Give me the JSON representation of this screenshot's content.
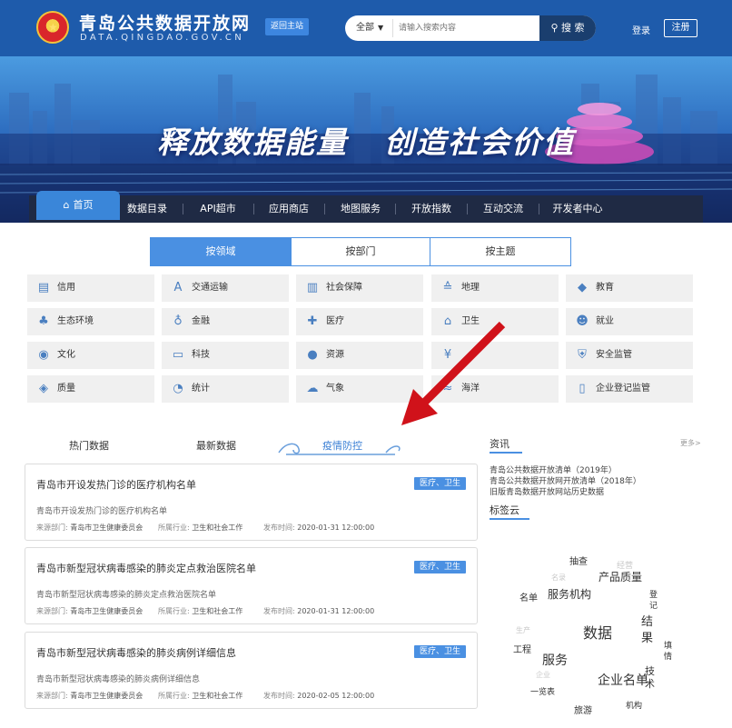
{
  "header": {
    "site_title": "青岛公共数据开放网",
    "site_subtitle": "DATA.QINGDAO.GOV.CN",
    "back_label": "返回主站",
    "search_scope": "全部",
    "search_placeholder": "请输入搜索内容",
    "search_button": "搜 索",
    "login": "登录",
    "register": "注册"
  },
  "banner": {
    "slogan_left": "释放数据能量",
    "slogan_right": "创造社会价值"
  },
  "nav": {
    "home": "首页",
    "items": [
      "数据目录",
      "API超市",
      "应用商店",
      "地图服务",
      "开放指数",
      "互动交流",
      "开发者中心"
    ]
  },
  "category_tabs": [
    "按领域",
    "按部门",
    "按主题"
  ],
  "domains": [
    {
      "label": "信用",
      "icon": "credit-card-icon"
    },
    {
      "label": "交通运输",
      "icon": "road-icon"
    },
    {
      "label": "社会保障",
      "icon": "building-icon"
    },
    {
      "label": "地理",
      "icon": "map-layer-icon"
    },
    {
      "label": "教育",
      "icon": "graduation-cap-icon"
    },
    {
      "label": "生态环境",
      "icon": "plant-icon"
    },
    {
      "label": "金融",
      "icon": "money-bag-icon"
    },
    {
      "label": "医疗",
      "icon": "medical-kit-icon"
    },
    {
      "label": "卫生",
      "icon": "health-house-icon"
    },
    {
      "label": "就业",
      "icon": "people-icon"
    },
    {
      "label": "文化",
      "icon": "globe-icon"
    },
    {
      "label": "科技",
      "icon": "monitor-icon"
    },
    {
      "label": "资源",
      "icon": "drop-icon"
    },
    {
      "label": "",
      "icon": "wheat-icon"
    },
    {
      "label": "安全监管",
      "icon": "shield-icon"
    },
    {
      "label": "质量",
      "icon": "badge-icon"
    },
    {
      "label": "统计",
      "icon": "pie-chart-icon"
    },
    {
      "label": "气象",
      "icon": "cloud-icon"
    },
    {
      "label": "海洋",
      "icon": "wave-icon"
    },
    {
      "label": "企业登记监管",
      "icon": "document-icon"
    }
  ],
  "data_tabs": [
    "热门数据",
    "最新数据",
    "疫情防控"
  ],
  "cards": [
    {
      "title": "青岛市开设发热门诊的医疗机构名单",
      "badge": "医疗、卫生",
      "desc": "青岛市开设发热门诊的医疗机构名单",
      "dept_label": "来源部门:",
      "dept": "青岛市卫生健康委员会",
      "industry_label": "所属行业:",
      "industry": "卫生和社会工作",
      "time_label": "发布时间:",
      "time": "2020-01-31 12:00:00"
    },
    {
      "title": "青岛市新型冠状病毒感染的肺炎定点救治医院名单",
      "badge": "医疗、卫生",
      "desc": "青岛市新型冠状病毒感染的肺炎定点救治医院名单",
      "dept_label": "来源部门:",
      "dept": "青岛市卫生健康委员会",
      "industry_label": "所属行业:",
      "industry": "卫生和社会工作",
      "time_label": "发布时间:",
      "time": "2020-01-31 12:00:00"
    },
    {
      "title": "青岛市新型冠状病毒感染的肺炎病例详细信息",
      "badge": "医疗、卫生",
      "desc": "青岛市新型冠状病毒感染的肺炎病例详细信息",
      "dept_label": "来源部门:",
      "dept": "青岛市卫生健康委员会",
      "industry_label": "所属行业:",
      "industry": "卫生和社会工作",
      "time_label": "发布时间:",
      "time": "2020-02-05 12:00:00"
    }
  ],
  "news": {
    "title": "资讯",
    "more": "更多>",
    "items": [
      "青岛公共数据开放清单（2019年）",
      "青岛公共数据开放网开放清单（2018年）",
      "旧版青岛数据开放网站历史数据"
    ]
  },
  "tags": {
    "title": "标签云",
    "words": [
      "抽查",
      "经营",
      "产品质量",
      "名录",
      "名单",
      "服务机构",
      "登",
      "记",
      "结",
      "果",
      "生产",
      "数据",
      "填",
      "工程",
      "情",
      "服务",
      "技",
      "术",
      "企业",
      "企业名单",
      "一览表",
      "旅游",
      "机构"
    ]
  }
}
